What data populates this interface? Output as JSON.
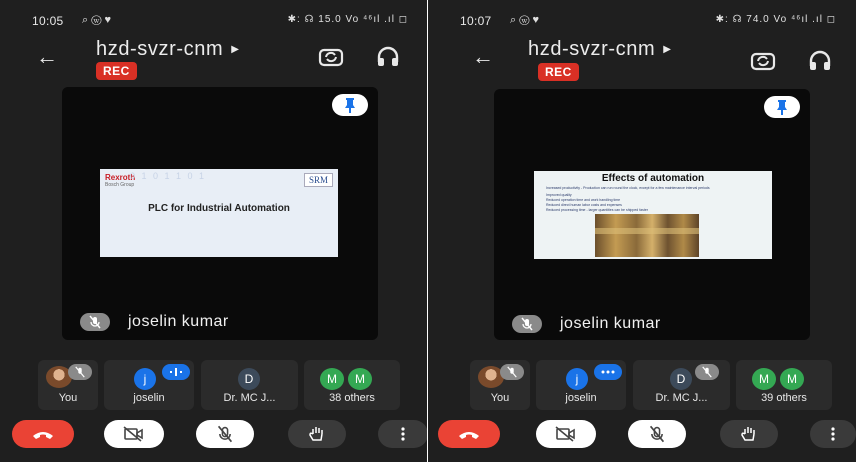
{
  "phone1": {
    "status": {
      "time": "10:05",
      "right": "✱: ☊ 15.0 Vo ⁴⁶ıl .ıl ◻"
    },
    "meeting_code": "hzd-svzr-cnm",
    "rec_label": "REC",
    "slide": {
      "logo_left": "Rexroth",
      "logo_left_sub": "Bosch Group",
      "logo_right": "SRM",
      "title": "PLC for Industrial Automation"
    },
    "speaker_name": "joselin kumar",
    "tiles": [
      {
        "label": "You"
      },
      {
        "label": "joselin",
        "initial": "j"
      },
      {
        "label": "Dr. MC J...",
        "initial": "D"
      },
      {
        "label": "38 others",
        "initials": [
          "M",
          "M"
        ]
      }
    ]
  },
  "phone2": {
    "status": {
      "time": "10:07",
      "right": "✱: ☊ 74.0 Vo ⁴⁶ıl .ıl ◻"
    },
    "meeting_code": "hzd-svzr-cnm",
    "rec_label": "REC",
    "slide": {
      "title": "Effects of automation",
      "bullets": [
        "Increased productivity - Production can run round the clock, except for a few maintenance interval periods",
        "Improved quality",
        "Reduced operation time and work handling time",
        "Reduced direct human labor costs and expenses",
        "Reduced processing time - larger quantities can be shipped faster"
      ]
    },
    "speaker_name": "joselin kumar",
    "tiles": [
      {
        "label": "You"
      },
      {
        "label": "joselin",
        "initial": "j"
      },
      {
        "label": "Dr. MC J...",
        "initial": "D"
      },
      {
        "label": "39 others",
        "initials": [
          "M",
          "M"
        ]
      }
    ]
  },
  "colors": {
    "background": "#1f1f1f",
    "rec": "#d93025",
    "end_call": "#ea4335",
    "blue": "#1a73e8",
    "green": "#34a853",
    "slate": "#3c4a5a"
  },
  "icons": [
    "back-arrow-icon",
    "switch-camera-icon",
    "headphones-icon",
    "pin-icon",
    "mic-off-icon",
    "end-call-icon",
    "video-off-icon",
    "raise-hand-icon",
    "more-vert-icon"
  ]
}
